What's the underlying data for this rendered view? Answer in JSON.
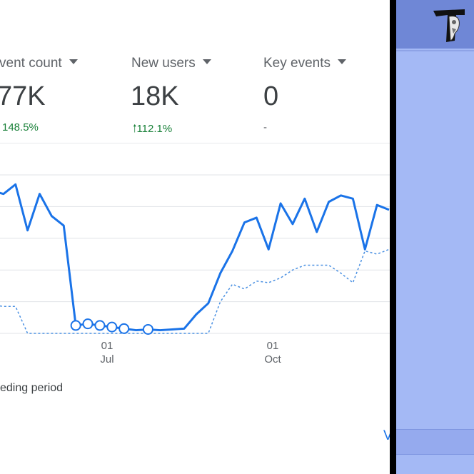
{
  "metrics": [
    {
      "label": "vent count",
      "value": "77K",
      "change": "148.5%",
      "arrow": ""
    },
    {
      "label": "New users",
      "value": "18K",
      "change": "112.1%",
      "arrow": "🠑"
    },
    {
      "label": "Key events",
      "value": "0",
      "change": "-",
      "arrow": ""
    }
  ],
  "chart_data": {
    "type": "line",
    "x_tick_labels": [
      {
        "day": "01",
        "month": "Jul"
      },
      {
        "day": "01",
        "month": "Oct"
      }
    ],
    "series": [
      {
        "values": [
          0.9,
          0.88,
          0.94,
          0.65,
          0.88,
          0.74,
          0.68,
          0.05,
          0.06,
          0.05,
          0.04,
          0.03,
          0.02,
          0.025,
          0.02,
          0.025,
          0.03,
          0.12,
          0.19,
          0.38,
          0.52,
          0.7,
          0.73,
          0.53,
          0.82,
          0.69,
          0.85,
          0.64,
          0.83,
          0.87,
          0.85,
          0.53,
          0.81,
          0.78
        ]
      },
      {
        "values": [
          0.18,
          0.17,
          0.17,
          0.0,
          0.0,
          0.0,
          0.0,
          0.0,
          0.0,
          0.0,
          0.0,
          0.0,
          0.0,
          0.0,
          0.0,
          0.0,
          0.0,
          0.0,
          0.0,
          0.2,
          0.31,
          0.28,
          0.33,
          0.32,
          0.35,
          0.4,
          0.43,
          0.43,
          0.43,
          0.38,
          0.32,
          0.52,
          0.5,
          0.53
        ]
      }
    ],
    "highlighted_points": [
      7,
      8,
      9,
      10,
      11,
      13
    ],
    "colors": {
      "current": "#1a73e8",
      "previous": "#4a90e2",
      "grid": "#e0e3e7"
    }
  },
  "legend": {
    "text": "eding period"
  },
  "footer": {
    "link_label": "V"
  }
}
